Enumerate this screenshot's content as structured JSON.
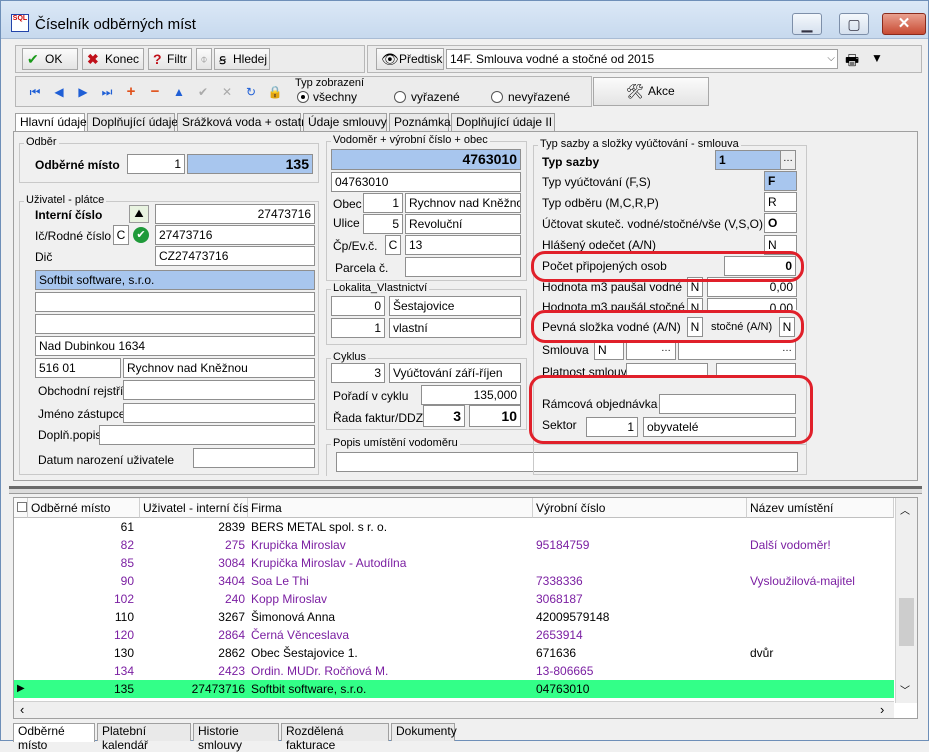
{
  "window": {
    "title": "Číselník odběrných míst",
    "app_icon_text": "SQL"
  },
  "toolbar": {
    "ok": "OK",
    "konec": "Konec",
    "filtr": "Filtr",
    "hledej": "Hledej",
    "predtisk": "Předtisk",
    "report_select": "14F. Smlouva vodné a stočné od 2015",
    "typ_zobrazeni_label": "Typ zobrazení",
    "radio_vsechny": "všechny",
    "radio_vyrazene": "vyřazené",
    "radio_nevyrazene": "nevyřazené",
    "akce": "Akce"
  },
  "tabs": [
    "Hlavní údaje",
    "Doplňující údaje",
    "Srážková voda + ostatní",
    "Údaje smlouvy",
    "Poznámka",
    "Doplňující údaje II"
  ],
  "odber": {
    "group": "Odběr",
    "label": "Odběrné místo",
    "small": "1",
    "value": "135"
  },
  "uzivatel": {
    "group": "Uživatel - plátce",
    "interni_label": "Interní číslo",
    "interni": "27473716",
    "ic_label": "Ič/Rodné číslo",
    "ic_flag": "C",
    "ic": "27473716",
    "dic_label": "Dič",
    "dic": "CZ27473716",
    "firma": "Softbit software, s.r.o.",
    "line2": "",
    "line3": "",
    "ulice": "Nad Dubinkou 1634",
    "psc": "516 01",
    "mesto": "Rychnov nad Kněžnou",
    "obch_label": "Obchodní rejstřík",
    "jmeno_label": "Jméno zástupce",
    "dopln_label": "Doplň.popis",
    "datum_label": "Datum narození uživatele"
  },
  "vodomer": {
    "group": "Vodoměr + výrobní číslo + obec",
    "main": "4763010",
    "cislo": "04763010",
    "obec_label": "Obec",
    "obec_num": "1",
    "obec": "Rychnov nad Kněžnou",
    "ulice_label": "Ulice",
    "ulice_num": "5",
    "ulice": "Revoluční",
    "cp_label": "Čp/Ev.č.",
    "cp_flag": "C",
    "cp": "13",
    "parcela_label": "Parcela č."
  },
  "lokalita": {
    "group": "Lokalita_Vlastnictví",
    "n1": "0",
    "v1": "Šestajovice",
    "n2": "1",
    "v2": "vlastní"
  },
  "cyklus": {
    "group": "Cyklus",
    "num": "3",
    "value": "Vyúčtování září-říjen",
    "poradi_label": "Pořadí v cyklu",
    "poradi": "135,000",
    "rada_label": "Řada faktur/DDZ",
    "rada1": "3",
    "rada2": "10"
  },
  "popis": {
    "group": "Popis umístění vodoměru"
  },
  "sazba": {
    "group": "Typ sazby a složky vyúčtování - smlouva",
    "typ_label": "Typ sazby",
    "typ": "1",
    "vyuct_label": "Typ vyúčtování (F,S)",
    "vyuct": "F",
    "odberu_label": "Typ odběru (M,C,R,P)",
    "odberu": "R",
    "uctovat_label": "Účtovat skuteč. vodné/stočné/vše (V,S,O)",
    "uctovat": "O",
    "hlaseny_label": "Hlášený odečet (A/N)",
    "hlaseny": "N",
    "pocet_label": "Počet připojených osob",
    "pocet": "0",
    "hm3_label": "Hodnota m3 paušal vodné",
    "hm3_flag": "N",
    "hm3": "0,00",
    "hm3b_label": "Hodnota m3 paušál stočné",
    "hm3b_flag": "N",
    "hm3b": "0,00",
    "pevna_label": "Pevná složka vodné (A/N)",
    "pevna": "N",
    "stocne_label": "stočné (A/N)",
    "stocne": "N",
    "smlouva_label": "Smlouva",
    "smlouva": "N",
    "platnost_label": "Platnost smlouvy",
    "ramcova_label": "Rámcová objednávka",
    "sektor_label": "Sektor",
    "sektor_num": "1",
    "sektor": "obyvatelé"
  },
  "grid": {
    "columns": [
      "Odběrné místo",
      "Uživatel - interní číslo",
      "Firma",
      "Výrobní číslo",
      "Název umístění"
    ],
    "rows": [
      {
        "om": "61",
        "ui": "2839",
        "firma": "BERS METAL spol. s r. o.",
        "vc": "",
        "nazev": "",
        "style": "black"
      },
      {
        "om": "82",
        "ui": "275",
        "firma": "Krupička Miroslav",
        "vc": "95184759",
        "nazev": "Další vodoměr!",
        "style": "purple"
      },
      {
        "om": "85",
        "ui": "3084",
        "firma": "Krupička Miroslav - Autodílna",
        "vc": "",
        "nazev": "",
        "style": "purple"
      },
      {
        "om": "90",
        "ui": "3404",
        "firma": "Soa Le Thi",
        "vc": "7338336",
        "nazev": "Vysloužilová-majitel",
        "style": "purple"
      },
      {
        "om": "102",
        "ui": "240",
        "firma": "Kopp Miroslav",
        "vc": "3068187",
        "nazev": "",
        "style": "purple"
      },
      {
        "om": "110",
        "ui": "3267",
        "firma": "Šimonová Anna",
        "vc": "42009579148",
        "nazev": "",
        "style": "black"
      },
      {
        "om": "120",
        "ui": "2864",
        "firma": "Černá Věnceslava",
        "vc": "2653914",
        "nazev": "",
        "style": "purple"
      },
      {
        "om": "130",
        "ui": "2862",
        "firma": "Obec Šestajovice 1.",
        "vc": "671636",
        "nazev": "dvůr",
        "style": "black"
      },
      {
        "om": "134",
        "ui": "2423",
        "firma": "Ordin. MUDr. Ročňová M.",
        "vc": "13-806665",
        "nazev": "",
        "style": "purple"
      },
      {
        "om": "135",
        "ui": "27473716",
        "firma": "Softbit software, s.r.o.",
        "vc": "04763010",
        "nazev": "",
        "style": "sel"
      }
    ]
  },
  "bottom_tabs": [
    "Odběrné místo",
    "Platební kalendář",
    "Historie smlouvy",
    "Rozdělená fakturace",
    "Dokumenty"
  ]
}
